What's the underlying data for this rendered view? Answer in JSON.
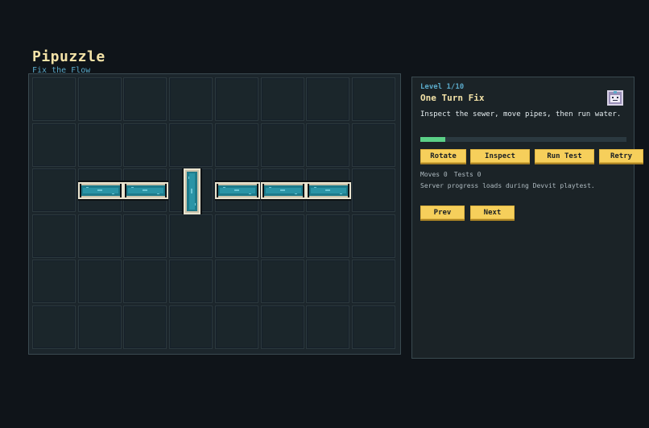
{
  "app": {
    "title": "Pipuzzle",
    "subtitle": "Fix the Flow"
  },
  "board": {
    "cols": 8,
    "rows": 6,
    "pipes": [
      {
        "col": 1,
        "row": 2,
        "orientation": "horizontal"
      },
      {
        "col": 2,
        "row": 2,
        "orientation": "horizontal"
      },
      {
        "col": 3,
        "row": 2,
        "orientation": "vertical"
      },
      {
        "col": 4,
        "row": 2,
        "orientation": "horizontal"
      },
      {
        "col": 5,
        "row": 2,
        "orientation": "horizontal"
      },
      {
        "col": 6,
        "row": 2,
        "orientation": "horizontal"
      }
    ]
  },
  "panel": {
    "level": "Level 1/10",
    "title": "One Turn Fix",
    "description": "Inspect the sewer, move pipes, then run water.",
    "progress": 0.12,
    "buttons": {
      "rotate": "Rotate",
      "inspect": "Inspect",
      "run_test": "Run Test",
      "retry": "Retry",
      "prev": "Prev",
      "next": "Next"
    },
    "stats": {
      "moves": "Moves 0",
      "tests": "Tests 0"
    },
    "note": "Server progress loads during Devvit playtest.",
    "avatar_icon": "robot-plumber-icon"
  },
  "colors": {
    "background": "#0f1419",
    "title": "#f3e2a7",
    "accent": "#5aa9c9",
    "button": "#f6cf5b",
    "progress": "#5bd087",
    "water": "#1e7a8a",
    "pipe_frame": "#e9e3cf"
  }
}
